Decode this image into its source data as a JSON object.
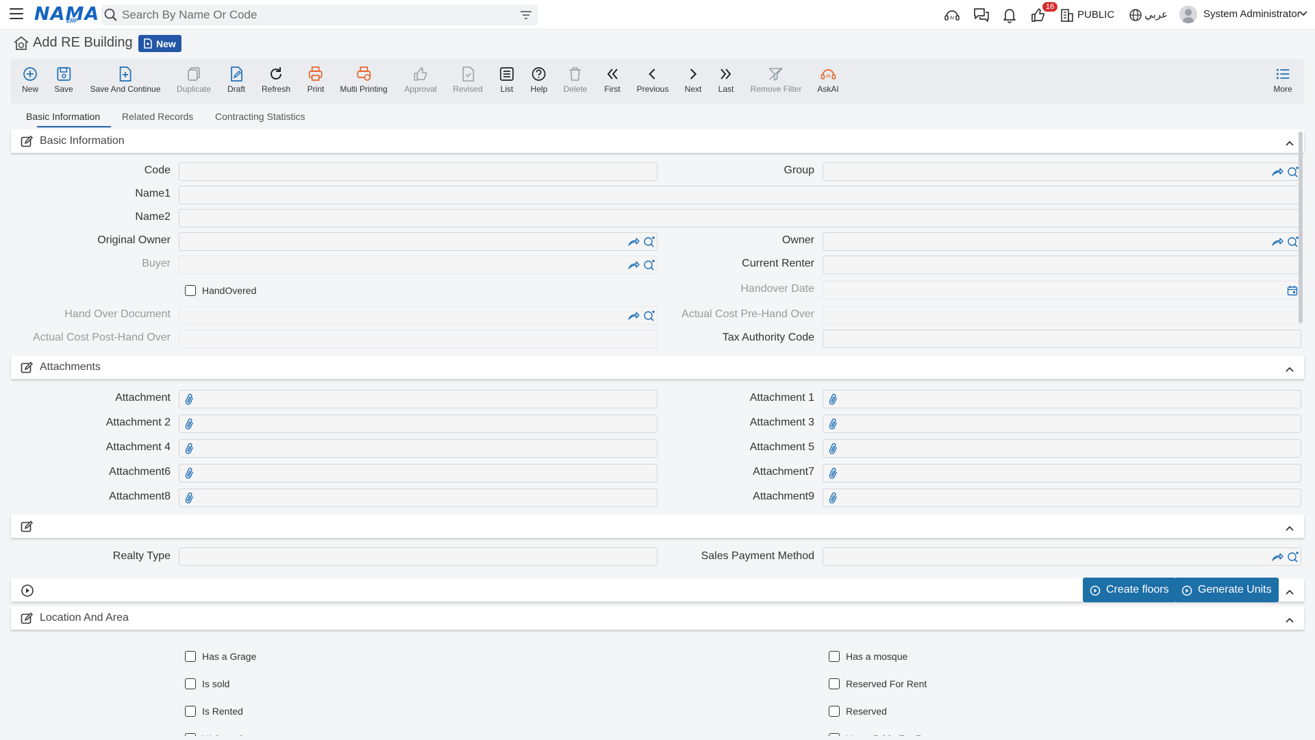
{
  "app": {
    "logo": "NAMA",
    "logo_sub": "ERP",
    "search_placeholder": "Search By Name Or Code",
    "notification_count": "16",
    "public_label": "PUBLIC",
    "language_label": "عربي",
    "user_name": "System Administrator"
  },
  "page": {
    "title": "Add RE Building",
    "mode_badge": "New"
  },
  "toolbar": [
    {
      "label": "New",
      "icon": "plus-circle-icon",
      "color": "#1f6fb5"
    },
    {
      "label": "Save",
      "icon": "save-icon",
      "color": "#1f6fb5"
    },
    {
      "label": "Save And Continue",
      "icon": "save-continue-icon",
      "color": "#1f6fb5"
    },
    {
      "label": "Duplicate",
      "icon": "duplicate-icon",
      "color": "#9aa0a8"
    },
    {
      "label": "Draft",
      "icon": "draft-icon",
      "color": "#1f6fb5"
    },
    {
      "label": "Refresh",
      "icon": "refresh-icon",
      "color": "#222222"
    },
    {
      "label": "Print",
      "icon": "print-icon",
      "color": "#e5622a"
    },
    {
      "label": "Multi Printing",
      "icon": "multi-print-icon",
      "color": "#e5622a"
    },
    {
      "label": "Approval",
      "icon": "thumb-up-icon",
      "color": "#9aa0a8"
    },
    {
      "label": "Revised",
      "icon": "revised-icon",
      "color": "#9aa0a8"
    },
    {
      "label": "List",
      "icon": "list-icon",
      "color": "#222222"
    },
    {
      "label": "Help",
      "icon": "help-icon",
      "color": "#222222"
    },
    {
      "label": "Delete",
      "icon": "trash-icon",
      "color": "#9aa0a8"
    },
    {
      "label": "First",
      "icon": "first-icon",
      "color": "#222222"
    },
    {
      "label": "Previous",
      "icon": "previous-icon",
      "color": "#222222"
    },
    {
      "label": "Next",
      "icon": "next-icon",
      "color": "#222222"
    },
    {
      "label": "Last",
      "icon": "last-icon",
      "color": "#222222"
    },
    {
      "label": "Remove Filter",
      "icon": "remove-filter-icon",
      "color": "#9aa0a8"
    },
    {
      "label": "AskAI",
      "icon": "askai-icon",
      "color": "#e5622a"
    },
    {
      "label": "More",
      "icon": "more-list-icon",
      "color": "#1f6fb5"
    }
  ],
  "tabs": [
    {
      "label": "Basic Information",
      "active": true
    },
    {
      "label": "Related Records",
      "active": false
    },
    {
      "label": "Contracting Statistics",
      "active": false
    }
  ],
  "sections": {
    "basic": "Basic Information",
    "attachments": "Attachments",
    "unnamed": "",
    "actions": "",
    "location": "Location And Area"
  },
  "basic_fields": {
    "code": "Code",
    "group": "Group",
    "name1": "Name1",
    "name2": "Name2",
    "original_owner": "Original Owner",
    "owner": "Owner",
    "buyer": "Buyer",
    "current_renter": "Current Renter",
    "handovered": "HandOvered",
    "handover_date": "Handover Date",
    "hand_over_document": "Hand Over Document",
    "actual_cost_pre": "Actual Cost Pre-Hand Over",
    "actual_cost_post": "Actual Cost Post-Hand Over",
    "tax_authority_code": "Tax Authority Code"
  },
  "attachments": [
    "Attachment",
    "Attachment 1",
    "Attachment 2",
    "Attachment 3",
    "Attachment 4",
    "Attachment 5",
    "Attachment6",
    "Attachment7",
    "Attachment8",
    "Attachment9"
  ],
  "other_fields": {
    "realty_type": "Realty Type",
    "sales_payment_method": "Sales Payment Method"
  },
  "actions": {
    "create_floors": "Create floors",
    "generate_units": "Generate Units"
  },
  "location_checks": [
    "Has a Grage",
    "Has a mosque",
    "Is sold",
    "Reserved For Rent",
    "Is Rented",
    "Reserved",
    "Waivered",
    "Unavailable For Rent"
  ],
  "colors": {
    "accent": "#1f5fa8",
    "action_button": "#1d6fa8",
    "badge": "#d32f2f"
  }
}
